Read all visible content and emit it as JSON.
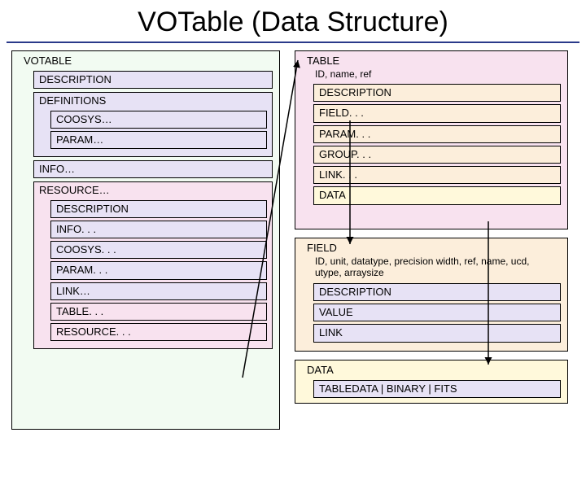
{
  "title": "VOTable (Data Structure)",
  "left": {
    "name": "VOTABLE",
    "desc": "DESCRIPTION",
    "defs": "DEFINITIONS",
    "defs_children": [
      "COOSYS…",
      "PARAM…"
    ],
    "info": "INFO…",
    "resource": "RESOURCE…",
    "resource_children": [
      "DESCRIPTION",
      "INFO. . .",
      "COOSYS. . .",
      "PARAM. . .",
      "LINK…",
      "TABLE. . .",
      "RESOURCE. . ."
    ]
  },
  "tr": {
    "name": "TABLE",
    "attrs": "ID, name, ref",
    "children": [
      "DESCRIPTION",
      "FIELD. . .",
      "PARAM. . .",
      "GROUP. . .",
      "LINK. . .",
      "DATA"
    ]
  },
  "field": {
    "name": "FIELD",
    "attrs": "ID, unit, datatype, precision width, ref, name, ucd, utype, arraysize",
    "children": [
      "DESCRIPTION",
      "VALUE",
      "LINK"
    ]
  },
  "data": {
    "name": "DATA",
    "child": "TABLEDATA | BINARY | FITS"
  }
}
